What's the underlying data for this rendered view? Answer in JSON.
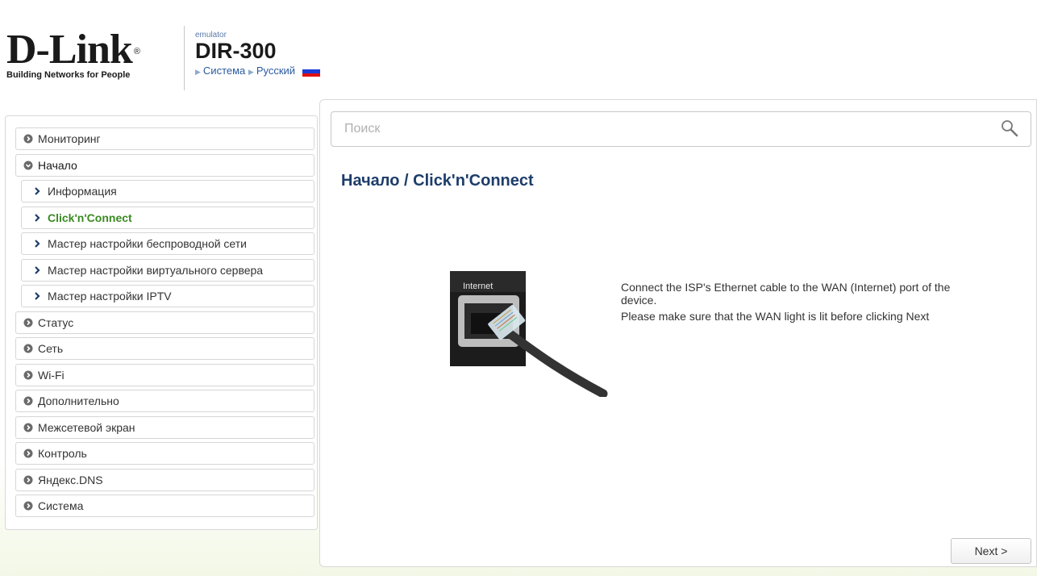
{
  "header": {
    "brand": "D-Link",
    "brand_reg": "®",
    "tagline": "Building Networks for People",
    "model_label": "emulator",
    "model": "DIR-300",
    "breadcrumb": [
      "Система",
      "Русский"
    ],
    "flag_colors": [
      "#ffffff",
      "#1a3bd6",
      "#e01010"
    ]
  },
  "search": {
    "placeholder": "Поиск",
    "icon": "magnifier-icon"
  },
  "sidebar": {
    "items": [
      {
        "label": "Мониторинг",
        "level": 0,
        "state": "collapsed"
      },
      {
        "label": "Начало",
        "level": 0,
        "state": "expanded"
      },
      {
        "label": "Информация",
        "level": 1,
        "state": "normal"
      },
      {
        "label": "Click'n'Connect",
        "level": 1,
        "state": "active"
      },
      {
        "label": "Мастер настройки беспроводной сети",
        "level": 1,
        "state": "normal"
      },
      {
        "label": "Мастер настройки виртуального сервера",
        "level": 1,
        "state": "normal"
      },
      {
        "label": "Мастер настройки IPTV",
        "level": 1,
        "state": "normal"
      },
      {
        "label": "Статус",
        "level": 0,
        "state": "collapsed"
      },
      {
        "label": "Сеть",
        "level": 0,
        "state": "collapsed"
      },
      {
        "label": "Wi-Fi",
        "level": 0,
        "state": "collapsed"
      },
      {
        "label": "Дополнительно",
        "level": 0,
        "state": "collapsed"
      },
      {
        "label": "Межсетевой экран",
        "level": 0,
        "state": "collapsed"
      },
      {
        "label": "Контроль",
        "level": 0,
        "state": "collapsed"
      },
      {
        "label": "Яндекс.DNS",
        "level": 0,
        "state": "collapsed"
      },
      {
        "label": "Система",
        "level": 0,
        "state": "collapsed"
      }
    ],
    "accent_active": "#3a8a22"
  },
  "main": {
    "title": "Начало /  Click'n'Connect",
    "port_label": "Internet",
    "instructions": [
      "Connect the ISP's Ethernet cable to the WAN (Internet) port of the device.",
      "Please make sure that the WAN light is lit before clicking Next"
    ],
    "next_label": "Next >"
  },
  "colors": {
    "title": "#1d3d6a",
    "breadcrumb": "#2a5aa0"
  }
}
